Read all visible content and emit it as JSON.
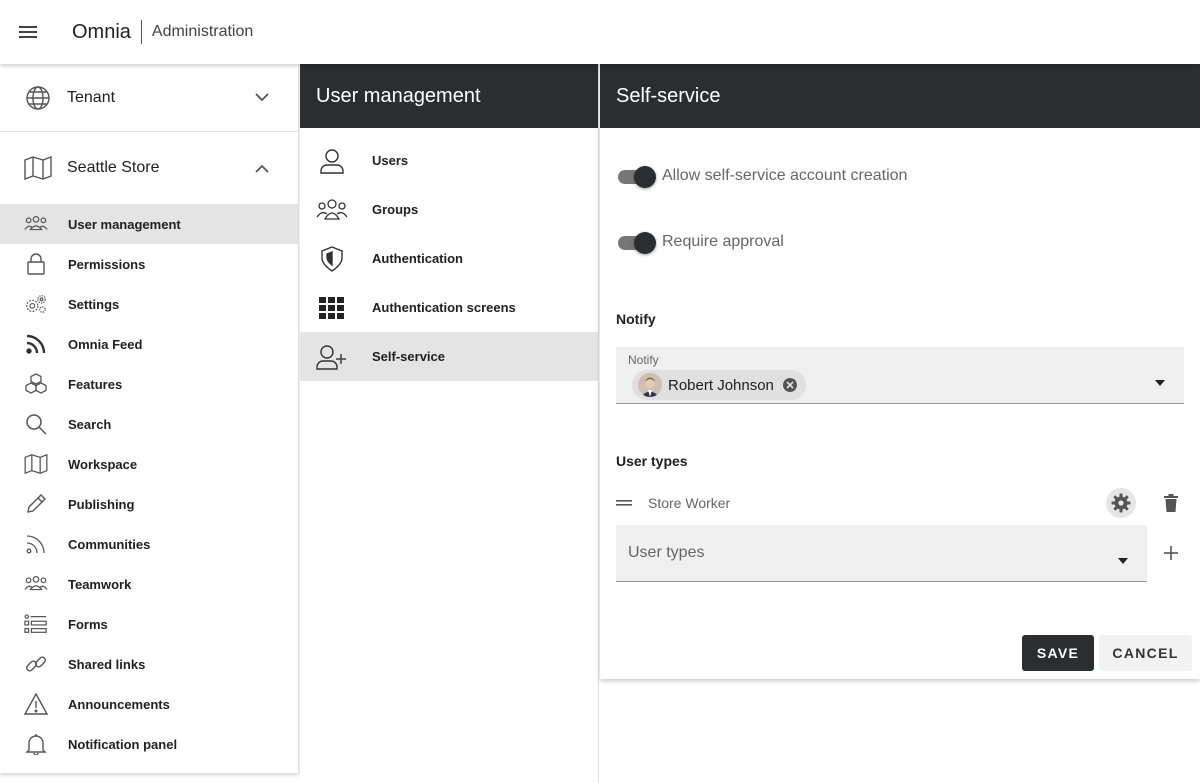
{
  "header": {
    "brand": "Omnia",
    "subtitle": "Administration"
  },
  "sidebar": {
    "groups": [
      {
        "label": "Tenant",
        "icon": "globe-icon",
        "expanded": false
      },
      {
        "label": "Seattle Store",
        "icon": "map-icon",
        "expanded": true
      }
    ],
    "items": [
      {
        "label": "User management",
        "icon": "people-icon",
        "active": true
      },
      {
        "label": "Permissions",
        "icon": "lock-icon"
      },
      {
        "label": "Settings",
        "icon": "gears-icon"
      },
      {
        "label": "Omnia Feed",
        "icon": "rss-icon"
      },
      {
        "label": "Features",
        "icon": "cubes-icon"
      },
      {
        "label": "Search",
        "icon": "search-icon"
      },
      {
        "label": "Workspace",
        "icon": "map-icon"
      },
      {
        "label": "Publishing",
        "icon": "pencil-icon"
      },
      {
        "label": "Communities",
        "icon": "rss-outline-icon"
      },
      {
        "label": "Teamwork",
        "icon": "people-icon"
      },
      {
        "label": "Forms",
        "icon": "form-icon"
      },
      {
        "label": "Shared links",
        "icon": "link-icon"
      },
      {
        "label": "Announcements",
        "icon": "warning-icon"
      },
      {
        "label": "Notification panel",
        "icon": "bell-icon"
      }
    ]
  },
  "middle": {
    "title": "User management",
    "items": [
      {
        "label": "Users",
        "icon": "user-icon"
      },
      {
        "label": "Groups",
        "icon": "group-icon"
      },
      {
        "label": "Authentication",
        "icon": "shield-icon"
      },
      {
        "label": "Authentication screens",
        "icon": "grid-icon"
      },
      {
        "label": "Self-service",
        "icon": "user-plus-icon",
        "active": true
      }
    ]
  },
  "main": {
    "title": "Self-service",
    "toggles": [
      {
        "label": "Allow self-service account creation",
        "on": true
      },
      {
        "label": "Require approval",
        "on": true
      }
    ],
    "notify": {
      "section_title": "Notify",
      "field_label": "Notify",
      "chips": [
        "Robert Johnson"
      ]
    },
    "user_types": {
      "section_title": "User types",
      "items": [
        "Store Worker"
      ],
      "placeholder": "User types"
    },
    "save_label": "SAVE",
    "cancel_label": "CANCEL"
  },
  "colors": {
    "dark": "#2b2d31",
    "active_bg": "#e4e4e4",
    "field_bg": "#f0f0f0"
  }
}
